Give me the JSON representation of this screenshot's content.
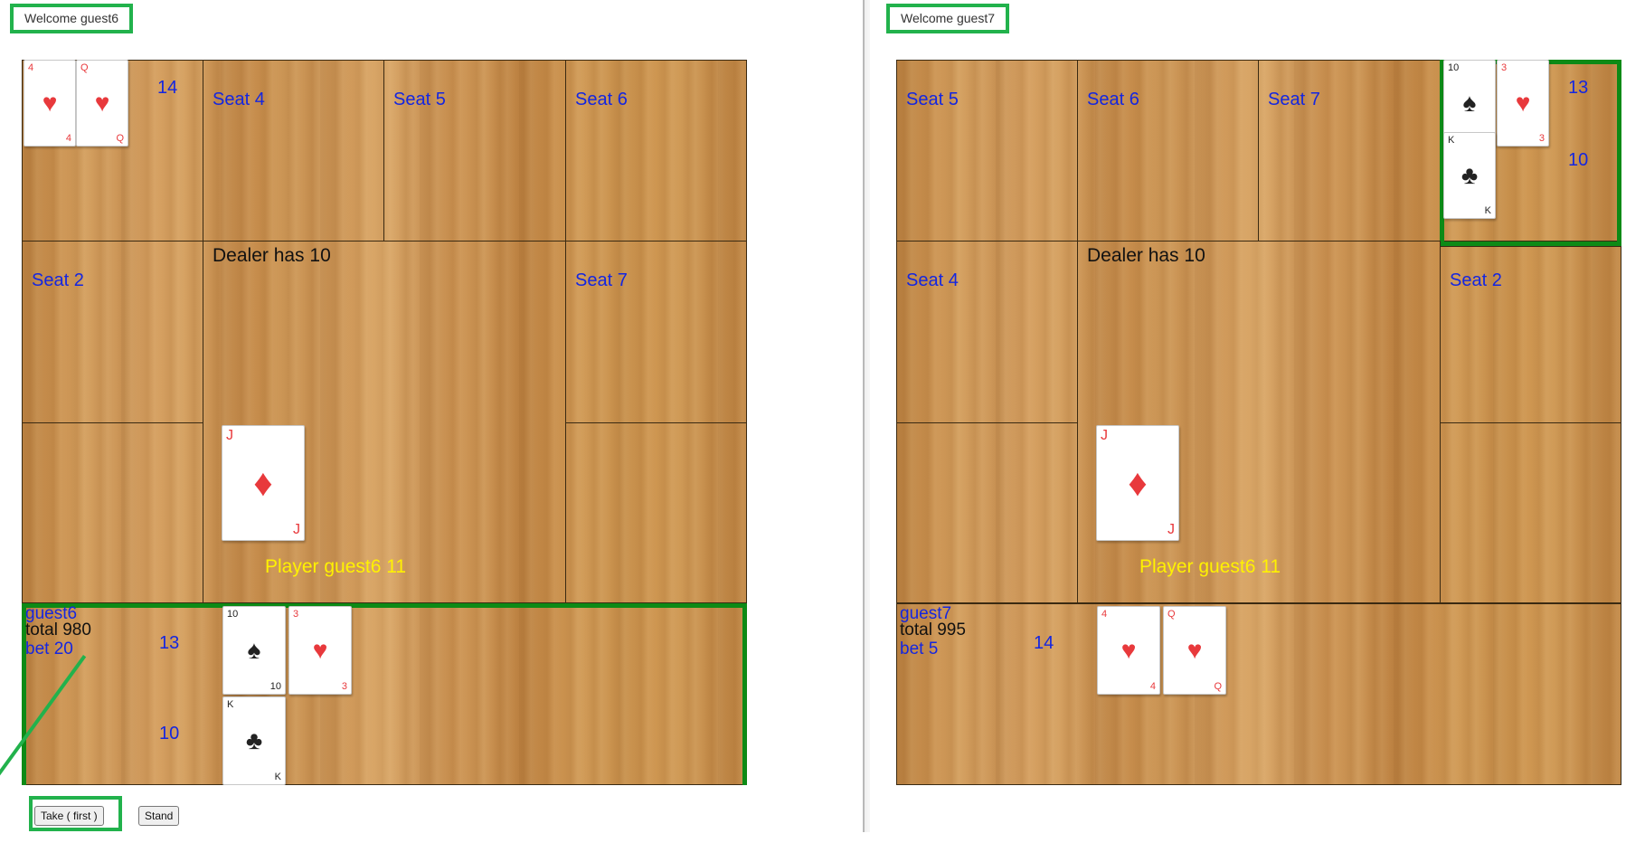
{
  "left": {
    "welcome": "Welcome guest6",
    "seats": {
      "s4": "Seat 4",
      "s5": "Seat 5",
      "s6": "Seat 6",
      "s2": "Seat 2",
      "s7": "Seat 7"
    },
    "top_hand": {
      "count": "14",
      "cards": [
        {
          "rank": "4",
          "suit": "♥"
        },
        {
          "rank": "Q",
          "suit": "♥"
        }
      ]
    },
    "dealer": {
      "text": "Dealer has 10",
      "card": {
        "rank": "J",
        "suit": "♦"
      },
      "player_line": "Player guest6 11"
    },
    "me": {
      "name": "guest6",
      "total": "total 980",
      "bet": "bet 20",
      "count_upper": "13",
      "count_lower": "10",
      "cards_upper": [
        {
          "rank": "10",
          "suit": "♠"
        },
        {
          "rank": "3",
          "suit": "♥"
        }
      ],
      "cards_lower": [
        {
          "rank": "K",
          "suit": "♣"
        }
      ]
    },
    "buttons": {
      "take": "Take ( first )",
      "stand": "Stand"
    }
  },
  "right": {
    "welcome": "Welcome guest7",
    "seats": {
      "s5": "Seat 5",
      "s6": "Seat 6",
      "s7": "Seat 7",
      "s4": "Seat 4",
      "s2": "Seat 2"
    },
    "corner_hand": {
      "count_upper": "13",
      "count_lower": "10",
      "cards_upper": [
        {
          "rank": "10",
          "suit": "♠"
        },
        {
          "rank": "3",
          "suit": "♥"
        }
      ],
      "cards_lower": [
        {
          "rank": "K",
          "suit": "♣"
        }
      ]
    },
    "dealer": {
      "text": "Dealer has 10",
      "card": {
        "rank": "J",
        "suit": "♦"
      },
      "player_line": "Player guest6 11"
    },
    "me": {
      "name": "guest7",
      "total": "total 995",
      "bet": "bet 5",
      "count": "14",
      "cards": [
        {
          "rank": "4",
          "suit": "♥"
        },
        {
          "rank": "Q",
          "suit": "♥"
        }
      ]
    }
  },
  "colors": {
    "highlight": "#22b24c",
    "active_seat": "#0d8a16",
    "seat_label": "#1426e0",
    "player_line": "#fff200"
  }
}
